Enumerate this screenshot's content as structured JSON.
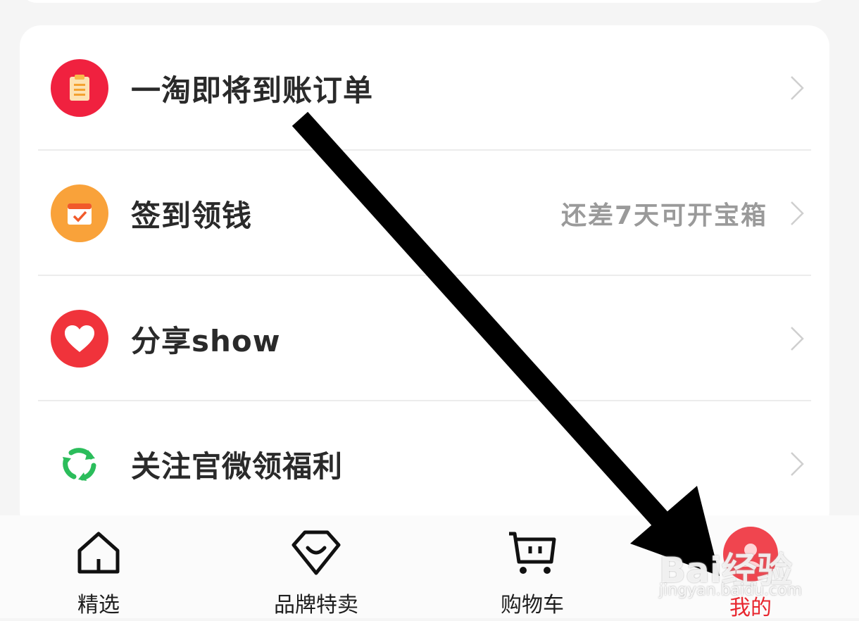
{
  "menu": {
    "items": [
      {
        "label": "一淘即将到账订单",
        "hint": "",
        "icon": "clipboard-icon",
        "icon_bg": "#f0213f"
      },
      {
        "label": "签到领钱",
        "hint": "还差7天可开宝箱",
        "icon": "calendar-check-icon",
        "icon_bg": "#f9a23a"
      },
      {
        "label": "分享show",
        "hint": "",
        "icon": "heart-icon",
        "icon_bg": "#f0333b"
      },
      {
        "label": "关注官微领福利",
        "hint": "",
        "icon": "recycle-icon",
        "icon_bg": "#2bbd5b"
      }
    ]
  },
  "tabbar": {
    "tabs": [
      {
        "label": "精选",
        "icon": "home-icon",
        "active": false
      },
      {
        "label": "品牌特卖",
        "icon": "diamond-smile-icon",
        "active": false
      },
      {
        "label": "购物车",
        "icon": "cart-icon",
        "active": false
      },
      {
        "label": "我的",
        "icon": "avatar-icon",
        "active": true
      }
    ],
    "active_color": "#e8262e"
  },
  "watermark": {
    "word": "Bai经验",
    "url": "jingyan.baidu.com"
  }
}
